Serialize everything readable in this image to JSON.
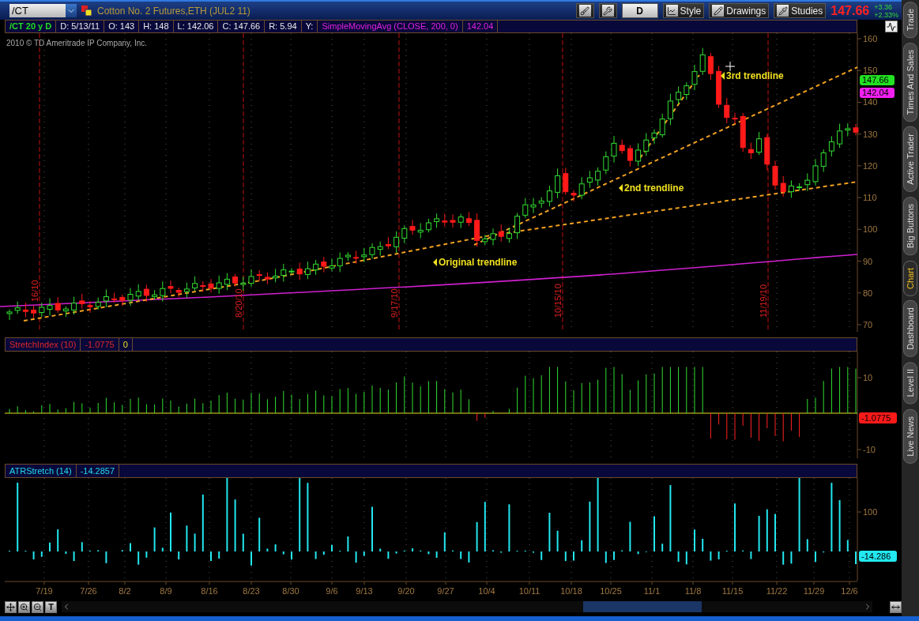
{
  "toolbar": {
    "symbol": "/CT",
    "description": "Cotton No. 2 Futures,ETH (JUL2 11)",
    "period": "D",
    "buttons": [
      "Style",
      "Drawings",
      "Studies"
    ],
    "last_price": "147.66",
    "change": "+3.36",
    "change_percent": "+2.33%"
  },
  "info_bar": [
    {
      "kind": "symbol",
      "text": "/CT 20 y D"
    },
    {
      "kind": "plain",
      "text": "D: 5/13/11"
    },
    {
      "kind": "plain",
      "text": "O: 143"
    },
    {
      "kind": "plain",
      "text": "H: 148"
    },
    {
      "kind": "plain",
      "text": "L: 142.06"
    },
    {
      "kind": "plain",
      "text": "C: 147.66"
    },
    {
      "kind": "plain",
      "text": "R: 5.94"
    },
    {
      "kind": "plain",
      "text": "Y:"
    },
    {
      "kind": "study",
      "text": "SimpleMovingAvg (CLOSE, 200, 0)"
    },
    {
      "kind": "study",
      "text": "142.04"
    }
  ],
  "price_chart": {
    "copyright": "2010 © TD Ameritrade IP Company, Inc.",
    "y_ticks": [
      "160",
      "150",
      "140",
      "130",
      "120",
      "110",
      "100",
      "90",
      "80",
      "70"
    ],
    "badges": [
      {
        "text": "147.66",
        "color": "#22e022"
      },
      {
        "text": "142.04",
        "color": "#f020f0"
      }
    ],
    "date_markers": [
      "16/10",
      "8/20/10",
      "9/17/10",
      "10/15/10",
      "11/19/10"
    ],
    "annotations": [
      "3rd trendline",
      "2nd trendline",
      "Original trendline"
    ]
  },
  "studies": [
    {
      "kind": "stretch",
      "title": "StretchIndex (10)",
      "value": "-1.0775",
      "extra": "0",
      "y_ticks": [
        "10",
        "-10"
      ],
      "badge": {
        "text": "-1.0775",
        "color": "#ff1a1a"
      }
    },
    {
      "kind": "atr",
      "title": "ATRStretch (14)",
      "value": "-14.2857",
      "y_ticks": [
        "100"
      ],
      "badge": {
        "text": "-14.286",
        "color": "#22e8f0"
      }
    }
  ],
  "date_axis": [
    "7/19",
    "7/26",
    "8/2",
    "8/9",
    "8/16",
    "8/23",
    "8/30",
    "9/6",
    "9/13",
    "9/20",
    "9/27",
    "10/4",
    "10/11",
    "10/18",
    "10/25",
    "11/1",
    "11/8",
    "11/15",
    "11/22",
    "11/29",
    "12/6"
  ],
  "bottom_tools": {
    "text_tool": "T"
  },
  "side_tabs": [
    {
      "label": "Trade",
      "selected": false
    },
    {
      "label": "Times And Sales",
      "selected": false
    },
    {
      "label": "Active Trader",
      "selected": false
    },
    {
      "label": "Big Buttons",
      "selected": false
    },
    {
      "label": "Chart",
      "selected": true
    },
    {
      "label": "Dashboard",
      "selected": false
    },
    {
      "label": "Level II",
      "selected": false
    },
    {
      "label": "Live News",
      "selected": false
    }
  ]
}
